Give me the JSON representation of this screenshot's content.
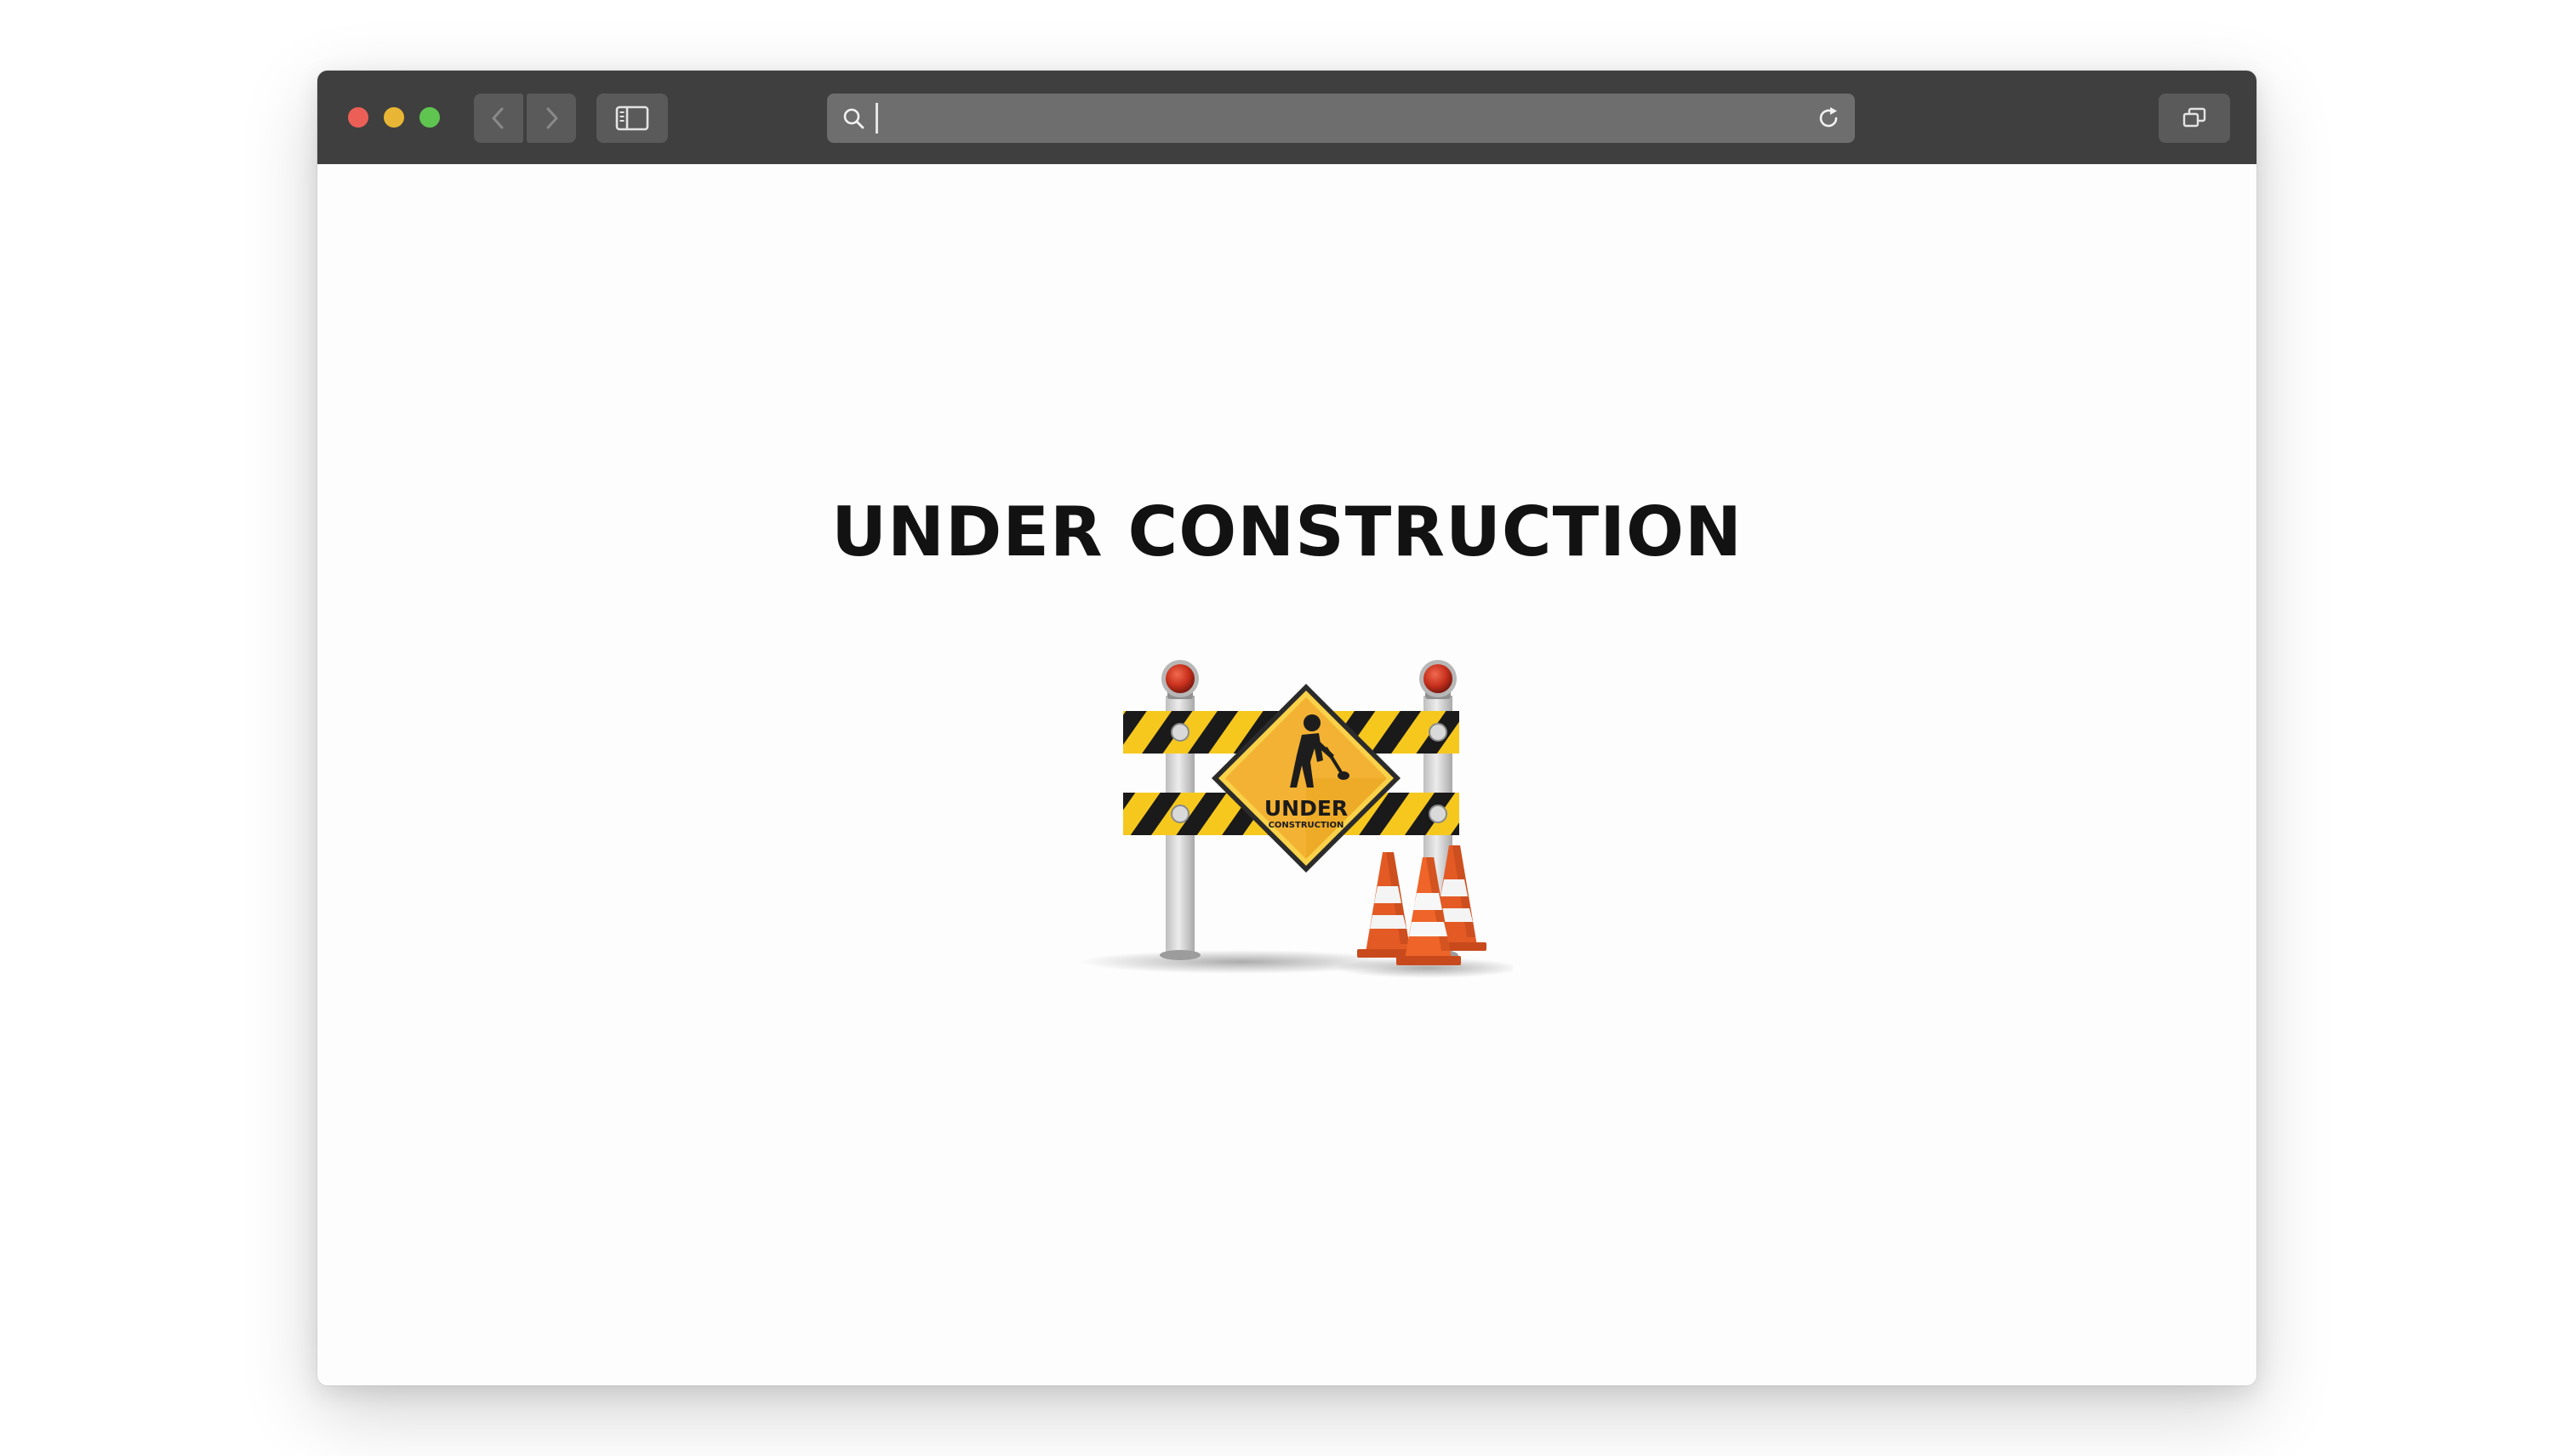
{
  "window": {
    "traffic_lights": {
      "close_color": "#ec5f57",
      "minimize_color": "#e8b634",
      "maximize_color": "#5fc450"
    }
  },
  "toolbar": {
    "icons": {
      "back": "chevron-left-icon",
      "forward": "chevron-right-icon",
      "sidebar": "sidebar-icon",
      "search": "magnifier-icon",
      "reload": "reload-icon",
      "tabs": "tab-overview-icon"
    },
    "address_bar": {
      "value": "",
      "placeholder": ""
    }
  },
  "page": {
    "title": "UNDER CONSTRUCTION",
    "illustration": {
      "icon": "under-construction-barrier",
      "sign_text_main": "UNDER",
      "sign_text_sub": "CONSTRUCTION"
    }
  },
  "colors": {
    "toolbar_bg": "#3f3f3f",
    "urlbar_bg": "#6e6e6e",
    "page_bg": "#fdfdfd",
    "title_color": "#121212",
    "stripe_yellow": "#f6c81d",
    "sign_orange": "#f3b233",
    "cone_orange": "#e35a25"
  }
}
